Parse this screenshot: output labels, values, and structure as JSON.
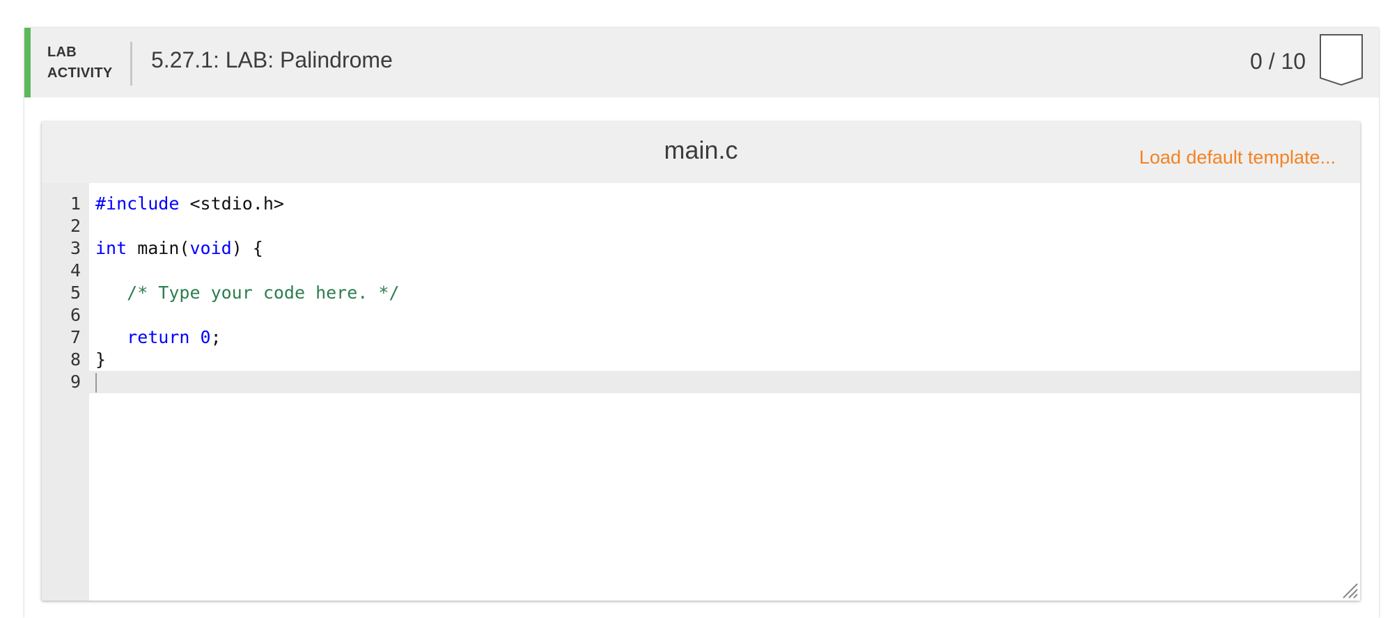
{
  "activity": {
    "type_line1": "LAB",
    "type_line2": "ACTIVITY",
    "title": "5.27.1: LAB: Palindrome",
    "score": "0 / 10",
    "accent_color": "#5cb85c"
  },
  "editor": {
    "filename": "main.c",
    "load_template_label": "Load default template...",
    "active_line": 9,
    "lines": [
      {
        "num": "1",
        "tokens": [
          {
            "t": "#include",
            "c": "kw"
          },
          {
            "t": " <stdio.h>",
            "c": ""
          }
        ]
      },
      {
        "num": "2",
        "tokens": []
      },
      {
        "num": "3",
        "tokens": [
          {
            "t": "int",
            "c": "kw"
          },
          {
            "t": " main(",
            "c": ""
          },
          {
            "t": "void",
            "c": "kw"
          },
          {
            "t": ") {",
            "c": ""
          }
        ]
      },
      {
        "num": "4",
        "tokens": []
      },
      {
        "num": "5",
        "tokens": [
          {
            "t": "   ",
            "c": ""
          },
          {
            "t": "/* Type your code here. */",
            "c": "cm"
          }
        ]
      },
      {
        "num": "6",
        "tokens": []
      },
      {
        "num": "7",
        "tokens": [
          {
            "t": "   ",
            "c": ""
          },
          {
            "t": "return",
            "c": "kw"
          },
          {
            "t": " ",
            "c": ""
          },
          {
            "t": "0",
            "c": "num"
          },
          {
            "t": ";",
            "c": ""
          }
        ]
      },
      {
        "num": "8",
        "tokens": [
          {
            "t": "}",
            "c": ""
          }
        ]
      },
      {
        "num": "9",
        "tokens": []
      }
    ]
  },
  "icons": {
    "badge": "score-badge-icon",
    "resize": "resize-handle-icon"
  }
}
